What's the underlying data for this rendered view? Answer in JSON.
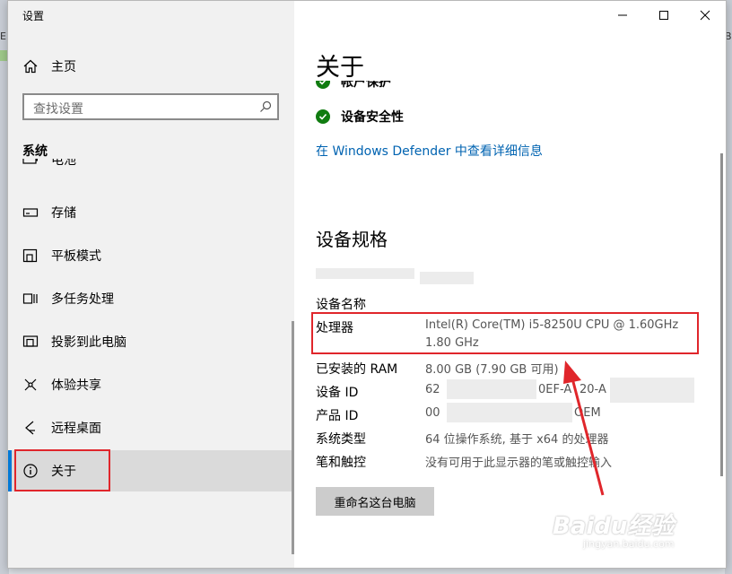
{
  "window": {
    "title": "设置"
  },
  "sidebar": {
    "home": "主页",
    "search_placeholder": "查找设置",
    "section": "系统",
    "cut_item": "电池",
    "items": [
      {
        "label": "存储",
        "icon": "storage-icon"
      },
      {
        "label": "平板模式",
        "icon": "tablet-mode-icon"
      },
      {
        "label": "多任务处理",
        "icon": "multitasking-icon"
      },
      {
        "label": "投影到此电脑",
        "icon": "project-icon"
      },
      {
        "label": "体验共享",
        "icon": "shared-experiences-icon"
      },
      {
        "label": "远程桌面",
        "icon": "remote-desktop-icon"
      },
      {
        "label": "关于",
        "icon": "info-icon",
        "selected": true
      }
    ]
  },
  "main": {
    "title": "关于",
    "account_protection": "帐户保护",
    "device_security": "设备安全性",
    "defender_link": "在 Windows Defender 中查看详细信息",
    "specs_heading": "设备规格",
    "specs": [
      {
        "label": "设备名称",
        "value": ""
      },
      {
        "label": "处理器",
        "value": "Intel(R) Core(TM) i5-8250U CPU @ 1.60GHz",
        "value2": "1.80 GHz"
      },
      {
        "label": "已安装的 RAM",
        "value": "8.00 GB (7.90 GB 可用)"
      },
      {
        "label": "设备 ID",
        "value": "62",
        "value_tail": "0EF-A",
        "value_tail2": "20-A"
      },
      {
        "label": "产品 ID",
        "value": "00",
        "value_tail": "OEM"
      },
      {
        "label": "系统类型",
        "value": "64 位操作系统, 基于 x64 的处理器"
      },
      {
        "label": "笔和触控",
        "value": "没有可用于此显示器的笔或触控输入"
      }
    ],
    "rename_button": "重命名这台电脑"
  },
  "background": {
    "left_tag": "E:/",
    "right_tag": "Be"
  },
  "watermark": {
    "logo": "Baidu经验",
    "sub": "jingyan.baidu.com"
  },
  "colors": {
    "accent": "#0078d7",
    "link": "#0063b1",
    "annotation": "#e0262b",
    "check": "#107c10"
  }
}
